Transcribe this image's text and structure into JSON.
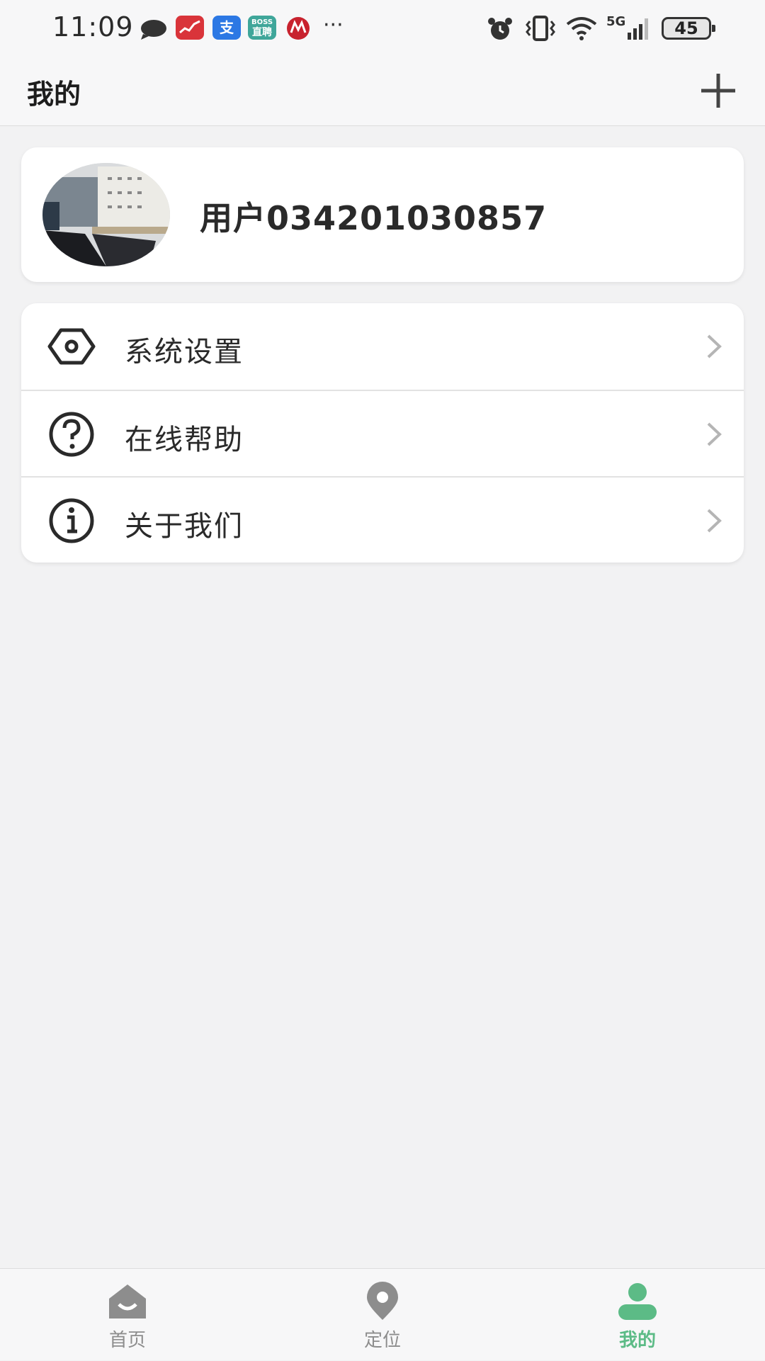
{
  "status_bar": {
    "time": "11:09",
    "notification_icons": [
      "chat-bubble-icon",
      "stock-app-icon",
      "alipay-icon",
      "boss-zhipin-icon",
      "cmb-bank-icon",
      "more-dots-icon"
    ],
    "alipay_glyph": "支",
    "boss_label_top": "BOSS",
    "boss_label_bottom": "直聘",
    "more_dots": "···",
    "network_label": "5G",
    "battery": "45"
  },
  "header": {
    "title": "我的",
    "add_icon": "plus-icon"
  },
  "profile": {
    "username": "用户034201030857",
    "avatar_icon": "avatar-photo"
  },
  "menu": {
    "items": [
      {
        "label": "系统设置",
        "icon": "settings-eye-icon"
      },
      {
        "label": "在线帮助",
        "icon": "help-question-icon"
      },
      {
        "label": "关于我们",
        "icon": "info-icon"
      }
    ]
  },
  "tab_bar": {
    "tabs": [
      {
        "label": "首页",
        "icon": "home-icon",
        "active": false
      },
      {
        "label": "定位",
        "icon": "location-pin-icon",
        "active": false
      },
      {
        "label": "我的",
        "icon": "user-icon",
        "active": true
      }
    ],
    "active_color": "#5cbb86",
    "inactive_color": "#8d8d8d"
  }
}
